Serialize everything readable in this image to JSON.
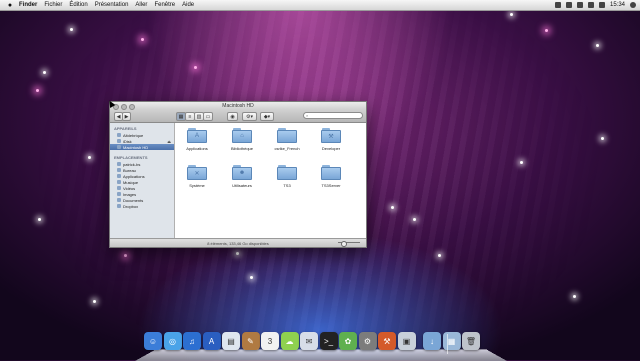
{
  "menubar": {
    "items": [
      "Finder",
      "Fichier",
      "Édition",
      "Présentation",
      "Aller",
      "Fenêtre",
      "Aide"
    ],
    "clock": "15:34"
  },
  "window": {
    "title": "Macintosh HD",
    "search_placeholder": "",
    "sidebar": {
      "devices_heading": "APPAREILS",
      "devices": [
        "Altdebrique",
        "iDisk",
        "Macintosh HD"
      ],
      "places_heading": "EMPLACEMENTS",
      "places": [
        "patrick-bs",
        "Bureau",
        "Applications",
        "Musique",
        "Vidéos",
        "Images",
        "Documents",
        "Dropbox"
      ]
    },
    "folders": [
      "Applications",
      "Bibliothèque",
      "csrike_French",
      "Developer",
      "Système",
      "Utilisateurs",
      "TS3",
      "TS3Server"
    ],
    "status": "8 éléments, 133,46 Go disponibles"
  },
  "dock": {
    "apps": [
      {
        "name": "finder-icon",
        "color": "#3b7dd8"
      },
      {
        "name": "safari-icon",
        "color": "#4aa3e8"
      },
      {
        "name": "itunes-icon",
        "color": "#2c6fd1"
      },
      {
        "name": "app-store-icon",
        "color": "#2a5ec0"
      },
      {
        "name": "preview-icon",
        "color": "#dfe6ef"
      },
      {
        "name": "address-book-icon",
        "color": "#b07a42"
      },
      {
        "name": "calendar-icon",
        "color": "#f1f1f1"
      },
      {
        "name": "messages-icon",
        "color": "#8fd14f"
      },
      {
        "name": "mail-icon",
        "color": "#d7dde8"
      },
      {
        "name": "terminal-icon",
        "color": "#222222"
      },
      {
        "name": "photos-icon",
        "color": "#5fb04f"
      },
      {
        "name": "system-prefs-icon",
        "color": "#7c7c7c"
      },
      {
        "name": "utility-icon",
        "color": "#d45a2a"
      },
      {
        "name": "image-tool-icon",
        "color": "#c8d0da"
      },
      {
        "name": "downloads-folder-icon",
        "color": "#7aa6d6"
      },
      {
        "name": "documents-stack-icon",
        "color": "#9ab8d8"
      },
      {
        "name": "trash-icon",
        "color": "#bfc4cb"
      }
    ]
  }
}
